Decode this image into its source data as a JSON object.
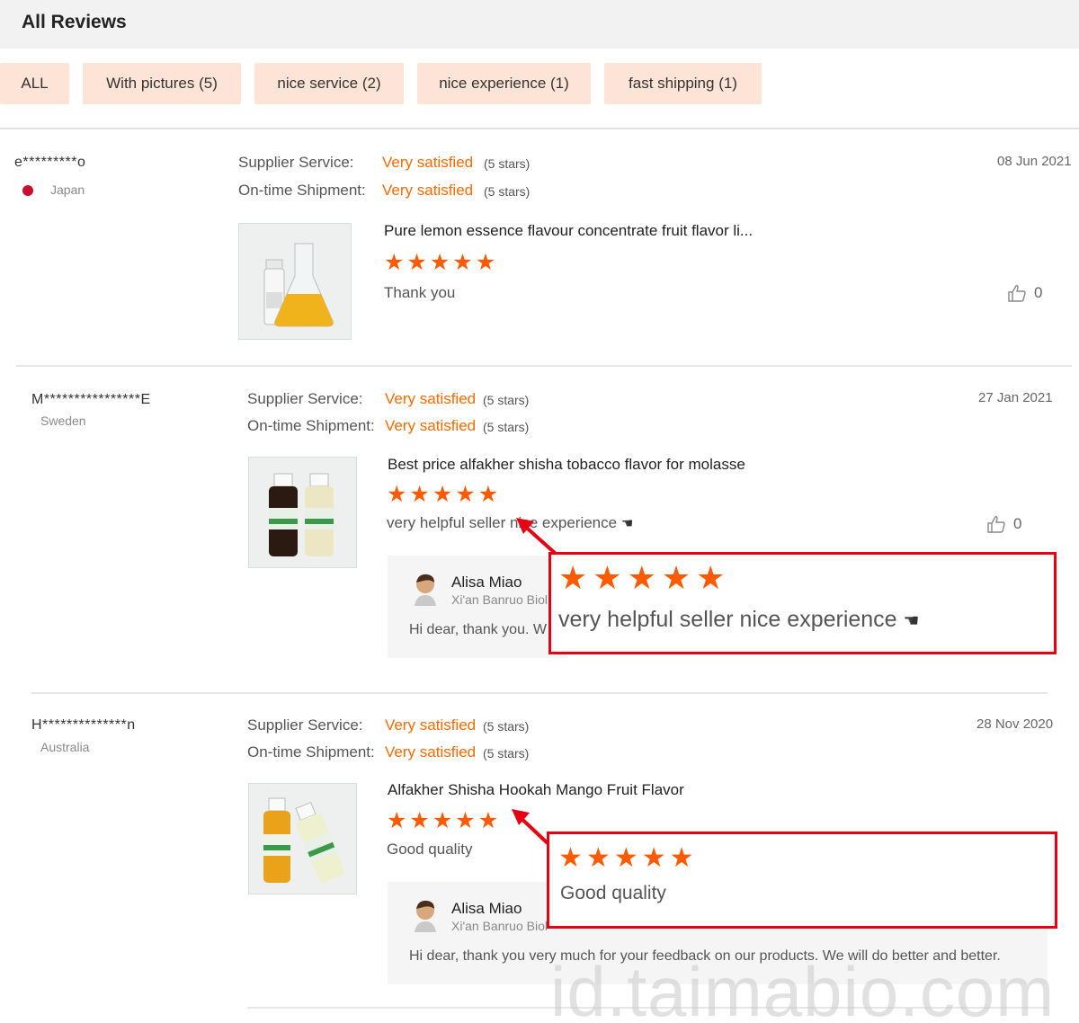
{
  "header": {
    "title": "All Reviews"
  },
  "filters": [
    {
      "label": "ALL"
    },
    {
      "label": "With pictures (5)"
    },
    {
      "label": "nice service (2)"
    },
    {
      "label": "nice experience (1)"
    },
    {
      "label": "fast shipping (1)"
    }
  ],
  "colors": {
    "accent": "#ff6a00",
    "chip_bg": "#fde4d6",
    "highlight_border": "#e60012"
  },
  "reviews": [
    {
      "user": "e*********o",
      "country": "Japan",
      "supplier_service_label": "Supplier Service:",
      "supplier_service_value": "Very satisfied",
      "supplier_service_stars": "(5 stars)",
      "shipment_label": "On-time Shipment:",
      "shipment_value": "Very satisfied",
      "shipment_stars": "(5 stars)",
      "date": "08 Jun 2021",
      "product": "Pure lemon essence flavour concentrate fruit flavor li...",
      "rating": 5,
      "comment": "Thank you",
      "likes": "0"
    },
    {
      "user": "M****************E",
      "country": "Sweden",
      "supplier_service_label": "Supplier Service:",
      "supplier_service_value": "Very satisfied",
      "supplier_service_stars": "(5 stars)",
      "shipment_label": "On-time Shipment:",
      "shipment_value": "Very satisfied",
      "shipment_stars": "(5 stars)",
      "date": "27 Jan 2021",
      "product": "Best price alfakher shisha tobacco flavor for molasse",
      "rating": 5,
      "comment": "very helpful seller nice experience",
      "likes": "0",
      "reply": {
        "name": "Alisa Miao",
        "company": "Xi'an Banruo Biol",
        "text": "Hi dear, thank you. W"
      },
      "zoom": {
        "rating": 5,
        "text": "very helpful seller nice experience"
      }
    },
    {
      "user": "H**************n",
      "country": "Australia",
      "supplier_service_label": "Supplier Service:",
      "supplier_service_value": "Very satisfied",
      "supplier_service_stars": "(5 stars)",
      "shipment_label": "On-time Shipment:",
      "shipment_value": "Very satisfied",
      "shipment_stars": "(5 stars)",
      "date": "28 Nov 2020",
      "product": "Alfakher Shisha Hookah Mango Fruit Flavor",
      "rating": 5,
      "comment": "Good quality",
      "reply": {
        "name": "Alisa Miao",
        "company": "Xi'an Banruo Biol",
        "text": "Hi dear, thank you very much for your feedback on our products. We will do better and better."
      },
      "zoom": {
        "rating": 5,
        "text": "Good quality"
      }
    }
  ],
  "watermark": "id.taimabio.com"
}
